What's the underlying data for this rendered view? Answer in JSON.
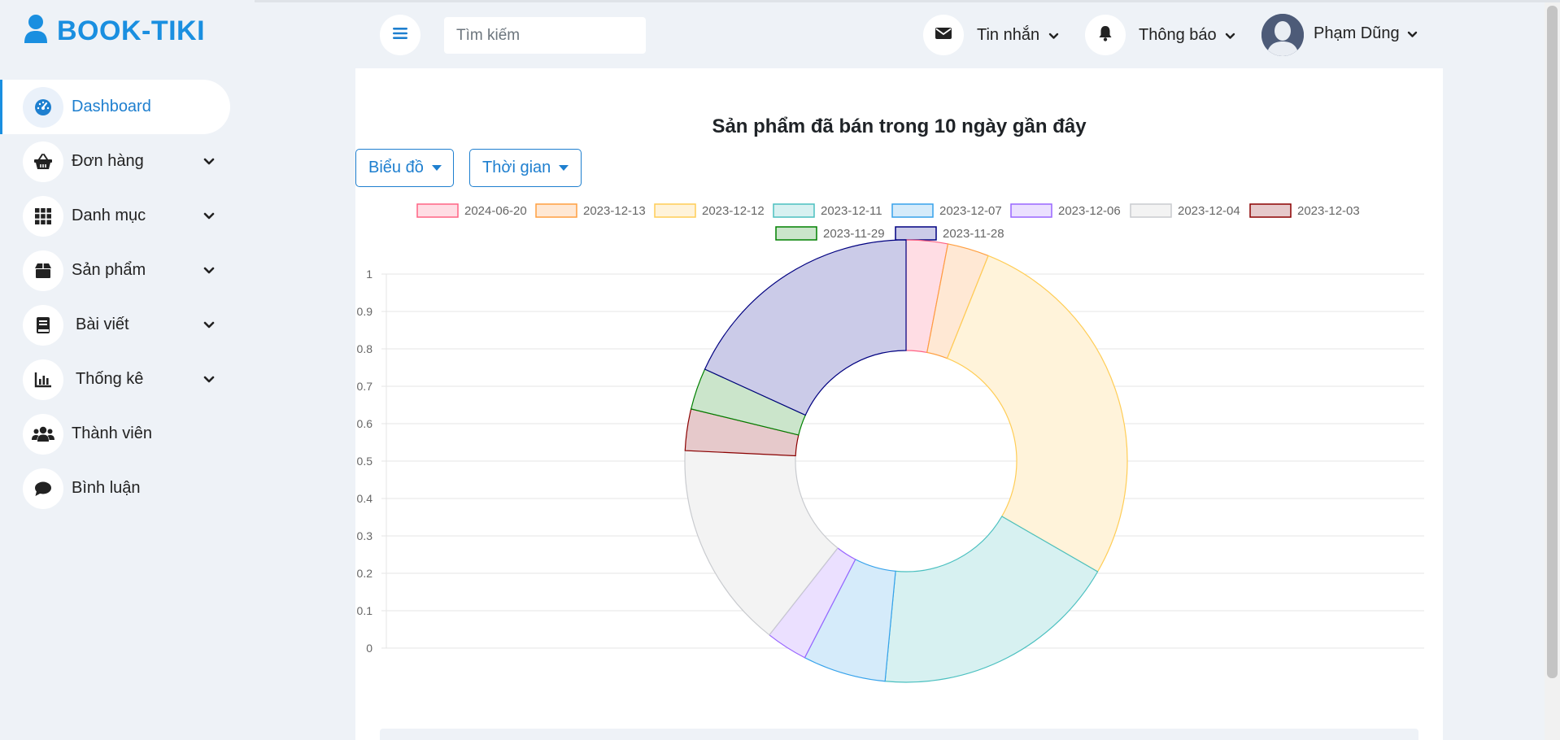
{
  "brand": {
    "title": "BOOK-TIKI",
    "icon": "user-icon",
    "color": "#1a8fe0"
  },
  "sidebar": {
    "items": [
      {
        "label": "Dashboard",
        "icon": "gauge-icon",
        "active": true,
        "has_submenu": false
      },
      {
        "label": "Đơn hàng",
        "icon": "basket-icon",
        "active": false,
        "has_submenu": true
      },
      {
        "label": "Danh mục",
        "icon": "grid-icon",
        "active": false,
        "has_submenu": true
      },
      {
        "label": "Sản phẩm",
        "icon": "box-icon",
        "active": false,
        "has_submenu": true
      },
      {
        "label": "Bài viết",
        "icon": "book-icon",
        "active": false,
        "has_submenu": true
      },
      {
        "label": "Thống kê",
        "icon": "bar-chart-icon",
        "active": false,
        "has_submenu": true
      },
      {
        "label": "Thành viên",
        "icon": "users-icon",
        "active": false,
        "has_submenu": false
      },
      {
        "label": "Bình luận",
        "icon": "comment-icon",
        "active": false,
        "has_submenu": false
      }
    ]
  },
  "header": {
    "menu_icon": "hamburger-icon",
    "search_placeholder": "Tìm kiếm",
    "messages_label": "Tin nhắn",
    "notifications_label": "Thông báo",
    "user_name": "Phạm Dũng"
  },
  "main": {
    "chart_type_button": "Biểu đồ",
    "time_button": "Thời gian"
  },
  "chart_data": {
    "type": "doughnut",
    "title": "Sản phẩm đã bán trong 10 ngày gần đây",
    "legend_position": "top",
    "grid": true,
    "ylim": [
      0,
      1
    ],
    "yticks": [
      "1",
      "0.9",
      "0.8",
      "0.7",
      "0.6",
      "0.5",
      "0.4",
      "0.3",
      "0.2",
      "0.1",
      "0"
    ],
    "labels": [
      "2024-06-20",
      "2023-12-13",
      "2023-12-12",
      "2023-12-11",
      "2023-12-07",
      "2023-12-06",
      "2023-12-04",
      "2023-12-03",
      "2023-11-29",
      "2023-11-28"
    ],
    "values": [
      1,
      1,
      9,
      6,
      2,
      1,
      5,
      1,
      1,
      6
    ],
    "fill_colors": [
      "#ffdde4",
      "#ffe8d4",
      "#fff3da",
      "#d7f1f1",
      "#d5ebfa",
      "#ebe0ff",
      "#f3f3f3",
      "#e6c9cb",
      "#cbe5cb",
      "#cbcbe8"
    ],
    "border_colors": [
      "#ff6384",
      "#ff9f40",
      "#ffcd56",
      "#4bc0c0",
      "#36a2eb",
      "#9966ff",
      "#c9cbcf",
      "#8b0000",
      "#008000",
      "#000080"
    ]
  }
}
